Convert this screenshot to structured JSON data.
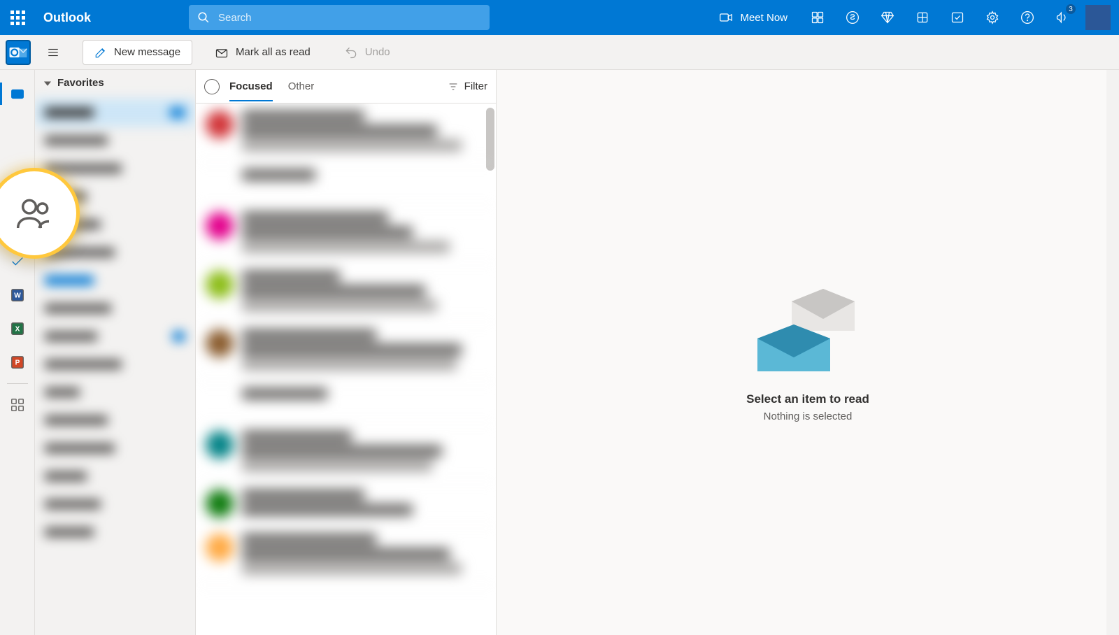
{
  "header": {
    "brand": "Outlook",
    "search_placeholder": "Search",
    "meet_now_label": "Meet Now",
    "notif_count": "3"
  },
  "toolbar": {
    "new_message_label": "New message",
    "mark_all_read_label": "Mark all as read",
    "undo_label": "Undo"
  },
  "folders": {
    "favorites_label": "Favorites"
  },
  "message_list": {
    "tabs": {
      "focused": "Focused",
      "other": "Other"
    },
    "filter_label": "Filter"
  },
  "reading_pane": {
    "empty_title": "Select an item to read",
    "empty_subtitle": "Nothing is selected"
  },
  "colors": {
    "primary": "#0078d4",
    "highlight_ring": "#ffc83d",
    "avatars": [
      "#d13438",
      "#e3008c",
      "#8cbd18",
      "#8a5c2e",
      "#038387",
      "#ffaa44"
    ]
  }
}
